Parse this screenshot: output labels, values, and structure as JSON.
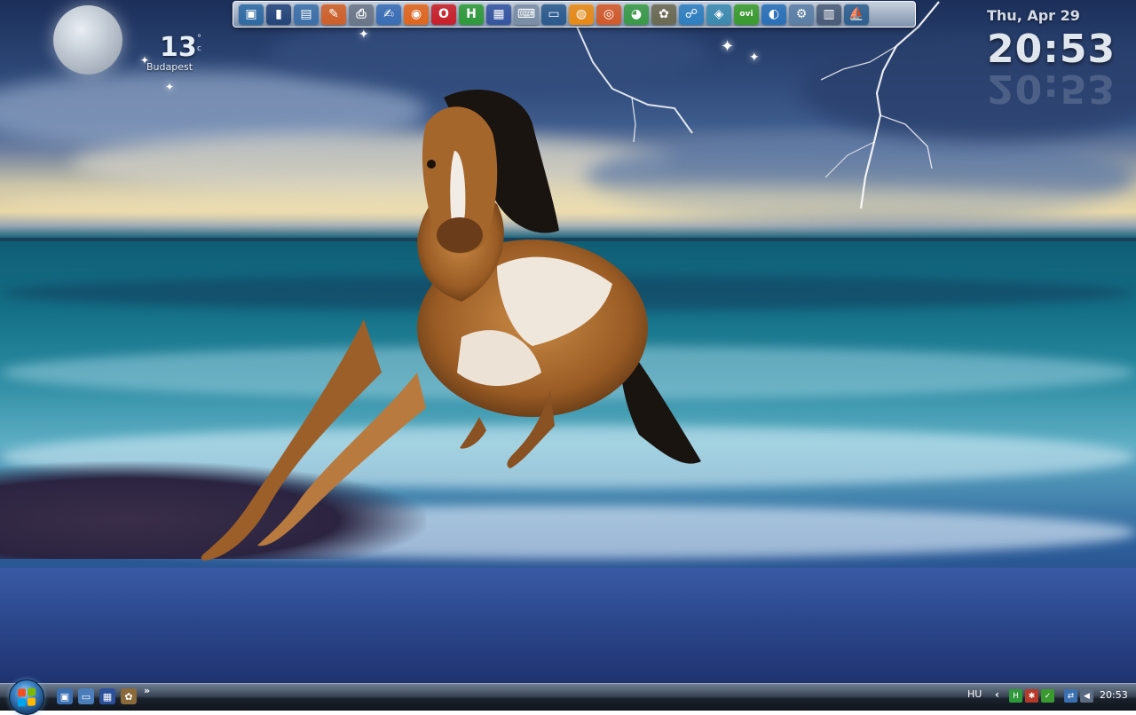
{
  "desktop": {
    "weather": {
      "temperature": "13",
      "degree": "°",
      "unit": "c",
      "city": "Budapest"
    },
    "clock": {
      "date": "Thu, Apr 29",
      "time": "20:53"
    }
  },
  "dock": {
    "icons": [
      {
        "name": "screen-capture-icon",
        "glyph": "▣",
        "color": "#2f6aa3"
      },
      {
        "name": "computer-tower-icon",
        "glyph": "▮",
        "color": "#24457a"
      },
      {
        "name": "documents-icon",
        "glyph": "▤",
        "color": "#3d6fa8"
      },
      {
        "name": "pencil-app-icon",
        "glyph": "✎",
        "color": "#d0602a"
      },
      {
        "name": "printer-icon",
        "glyph": "⎙",
        "color": "#6b7788"
      },
      {
        "name": "word-processor-icon",
        "glyph": "✍",
        "color": "#3a6db5"
      },
      {
        "name": "firefox-icon",
        "glyph": "◉",
        "color": "#e0661e"
      },
      {
        "name": "opera-icon",
        "glyph": "O",
        "color": "#c8202a"
      },
      {
        "name": "spreadsheet-icon",
        "glyph": "H",
        "color": "#2e9a3a"
      },
      {
        "name": "floppy-disk-icon",
        "glyph": "▦",
        "color": "#3555a0"
      },
      {
        "name": "keyboard-icon",
        "glyph": "⌨",
        "color": "#7a8ea6"
      },
      {
        "name": "monitor-icon",
        "glyph": "▭",
        "color": "#2b5a8e"
      },
      {
        "name": "orange-swirl-icon",
        "glyph": "◍",
        "color": "#e88a16"
      },
      {
        "name": "disc-icon",
        "glyph": "◎",
        "color": "#d25a2a"
      },
      {
        "name": "chrome-icon",
        "glyph": "◕",
        "color": "#3a9a48"
      },
      {
        "name": "gimp-icon",
        "glyph": "✿",
        "color": "#6b6a52"
      },
      {
        "name": "network-icon",
        "glyph": "☍",
        "color": "#2f7fc1"
      },
      {
        "name": "cube-icon",
        "glyph": "◈",
        "color": "#3c8ab0"
      },
      {
        "name": "ovi-icon",
        "glyph": "ovi",
        "color": "#3b9b2e"
      },
      {
        "name": "globe-icon",
        "glyph": "◐",
        "color": "#2a70b8"
      },
      {
        "name": "settings-icon",
        "glyph": "⚙",
        "color": "#5b7fa6"
      },
      {
        "name": "terminal-icon",
        "glyph": "▥",
        "color": "#4b5c78"
      },
      {
        "name": "ship-icon",
        "glyph": "⛵",
        "color": "#2f5f8f"
      }
    ]
  },
  "taskbar": {
    "quick_launch": [
      {
        "name": "quick-launch-screen-icon",
        "glyph": "▣",
        "color": "#3b6fb0"
      },
      {
        "name": "quick-launch-desktop-icon",
        "glyph": "▭",
        "color": "#4a7dba"
      },
      {
        "name": "quick-launch-save-icon",
        "glyph": "▦",
        "color": "#2b4f99"
      },
      {
        "name": "quick-launch-gimp-icon",
        "glyph": "✿",
        "color": "#8a6a3a"
      }
    ],
    "more": "»",
    "tray": {
      "language": "HU",
      "chevron": "‹",
      "time": "20:53",
      "icons": [
        {
          "name": "tray-h-icon",
          "glyph": "H",
          "color": "#2e9a3a"
        },
        {
          "name": "tray-app-icon",
          "glyph": "✱",
          "color": "#b53a2a"
        },
        {
          "name": "tray-check-icon",
          "glyph": "✓",
          "color": "#3a9a30"
        },
        {
          "name": "tray-network-icon",
          "glyph": "⇄",
          "color": "#3a6fb0"
        },
        {
          "name": "tray-volume-icon",
          "glyph": "◀",
          "color": "#5a6a80"
        }
      ]
    }
  }
}
